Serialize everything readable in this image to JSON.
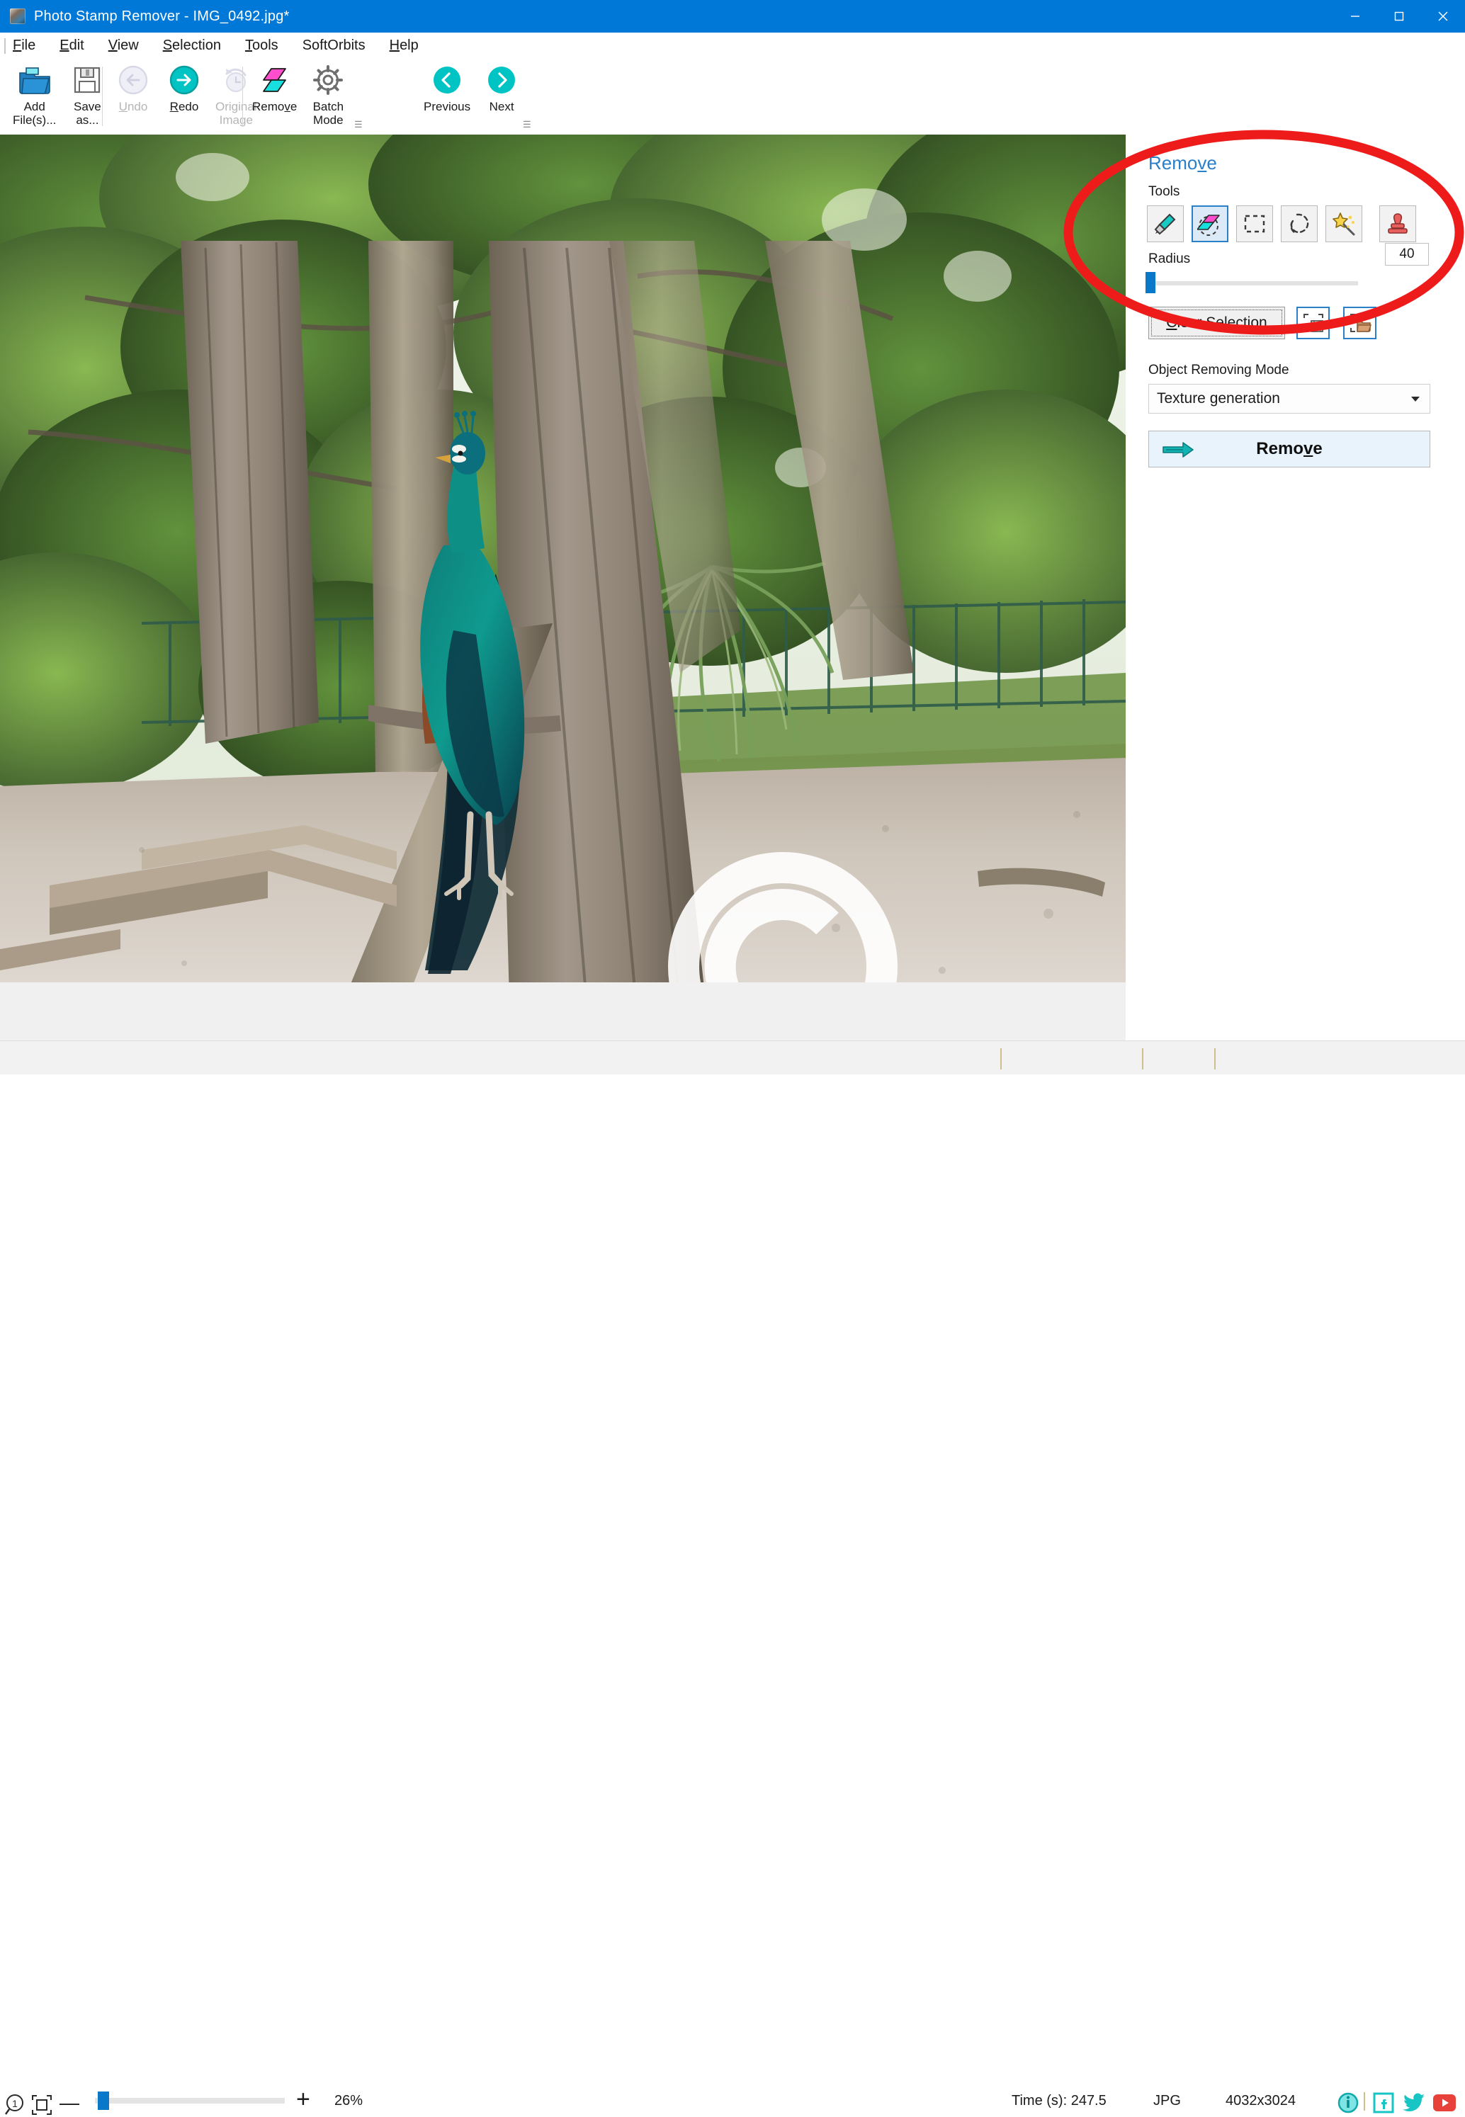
{
  "window": {
    "title": "Photo Stamp Remover - IMG_0492.jpg*",
    "app_icon": "photo-stamp-remover-icon",
    "controls": {
      "minimize": "minimize-icon",
      "maximize": "maximize-icon",
      "close": "close-icon"
    }
  },
  "menubar": {
    "items": [
      {
        "label": "File",
        "accel": "F"
      },
      {
        "label": "Edit",
        "accel": "E"
      },
      {
        "label": "View",
        "accel": "V"
      },
      {
        "label": "Selection",
        "accel": "S"
      },
      {
        "label": "Tools",
        "accel": "T"
      },
      {
        "label": "SoftOrbits",
        "accel": ""
      },
      {
        "label": "Help",
        "accel": "H"
      }
    ]
  },
  "ribbon": {
    "buttons": [
      {
        "name": "add-files",
        "label": "Add\nFile(s)...",
        "icon": "open-folder-icon",
        "enabled": true
      },
      {
        "name": "save-as",
        "label": "Save\nas...",
        "icon": "floppy-disk-icon",
        "enabled": true
      },
      {
        "name": "undo",
        "label": "Undo",
        "icon": "undo-arrow-icon",
        "enabled": false
      },
      {
        "name": "redo",
        "label": "Redo",
        "icon": "redo-arrow-icon",
        "enabled": true
      },
      {
        "name": "original-image",
        "label": "Original\nImage",
        "icon": "clock-revert-icon",
        "enabled": false
      },
      {
        "name": "remove",
        "label": "Remove",
        "icon": "eraser-icon",
        "enabled": true
      },
      {
        "name": "batch-mode",
        "label": "Batch\nMode",
        "icon": "gear-icon",
        "enabled": true
      },
      {
        "name": "previous",
        "label": "Previous",
        "icon": "chevron-left-circle-icon",
        "enabled": true
      },
      {
        "name": "next",
        "label": "Next",
        "icon": "chevron-right-circle-icon",
        "enabled": true
      }
    ],
    "overflow_marker": "≣"
  },
  "panel": {
    "title": "Remove",
    "tools_label": "Tools",
    "tools": [
      {
        "name": "marker-tool",
        "icon": "marker-pen-icon",
        "selected": false
      },
      {
        "name": "eraser-tool",
        "icon": "eraser-brush-icon",
        "selected": true
      },
      {
        "name": "rectangle-select-tool",
        "icon": "rectangle-selection-icon",
        "selected": false
      },
      {
        "name": "lasso-select-tool",
        "icon": "lasso-selection-icon",
        "selected": false
      },
      {
        "name": "magic-wand-tool",
        "icon": "magic-wand-icon",
        "selected": false
      },
      {
        "name": "clone-stamp-tool",
        "icon": "rubber-stamp-icon",
        "selected": false
      }
    ],
    "radius_label": "Radius",
    "radius_value": "40",
    "radius_slider_percent": 2,
    "clear_selection_label": "Clear Selection",
    "save_selection_icon": "save-selection-icon",
    "load_selection_icon": "load-selection-icon",
    "mode_label": "Object Removing Mode",
    "mode_value": "Texture generation",
    "mode_options": [
      "Texture generation"
    ],
    "remove_button_label": "Remove",
    "remove_button_icon": "right-arrow-icon"
  },
  "annotation": {
    "shape": "ellipse",
    "color": "#ee1b1b"
  },
  "canvas": {
    "watermark": "copyright-symbol-watermark",
    "image_subject": "peacock-on-tree-branch-photo"
  },
  "statusbar": {
    "zoom_in_icon": "magnifier-icon",
    "fit_icon": "fit-to-screen-icon",
    "minus_label": "—",
    "plus_label": "+",
    "zoom_level": "26%",
    "time_label": "Time (s): 247.5",
    "format_label": "JPG",
    "dimensions_label": "4032x3024",
    "social": [
      {
        "name": "info-icon",
        "color": "#18c5c5"
      },
      {
        "name": "facebook-icon",
        "color": "#18c5c5"
      },
      {
        "name": "twitter-icon",
        "color": "#18c5c5"
      },
      {
        "name": "youtube-icon",
        "color": "#e8413a"
      }
    ]
  },
  "colors": {
    "titlebar": "#0078d7",
    "accent_blue": "#2a7fc9",
    "teal": "#00bfbf",
    "magenta": "#ff4ecd",
    "annotation_red": "#ee1b1b"
  }
}
